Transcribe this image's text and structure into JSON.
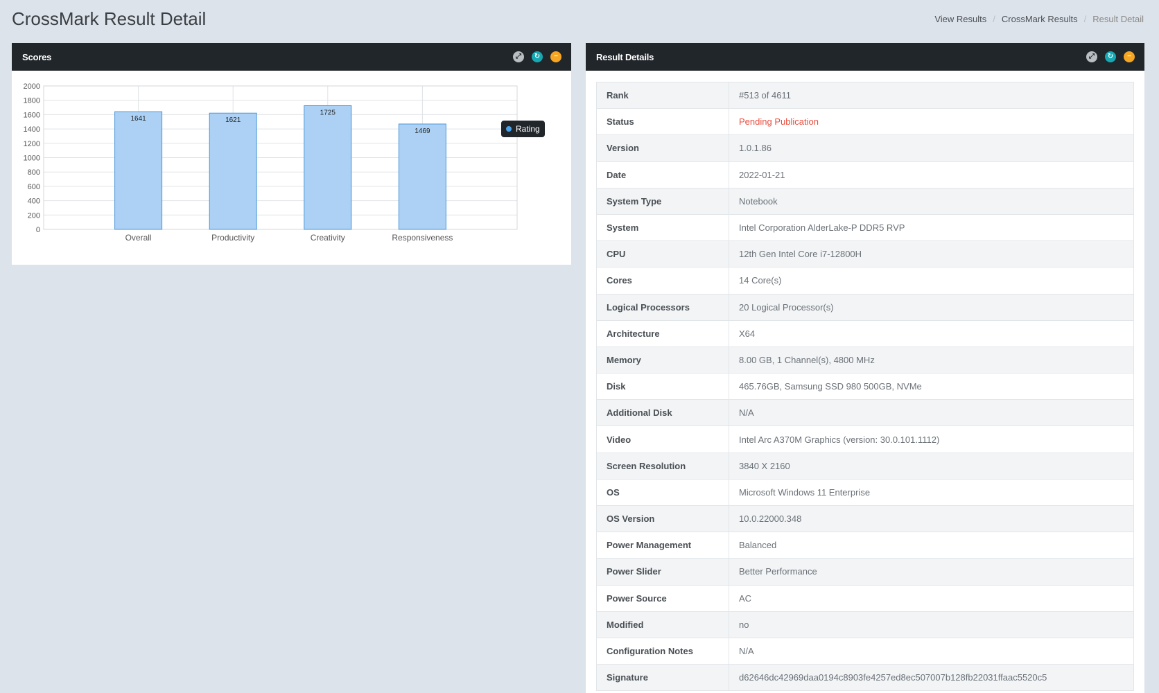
{
  "page": {
    "title": "CrossMark Result Detail",
    "breadcrumb": [
      "View Results",
      "CrossMark Results",
      "Result Detail"
    ]
  },
  "scores_panel": {
    "title": "Scores",
    "legend_label": "Rating",
    "tools": [
      "expand-icon",
      "refresh-icon",
      "minimize-icon"
    ]
  },
  "chart_data": {
    "type": "bar",
    "categories": [
      "Overall",
      "Productivity",
      "Creativity",
      "Responsiveness"
    ],
    "series": [
      {
        "name": "Rating",
        "values": [
          1641,
          1621,
          1725,
          1469
        ]
      }
    ],
    "data_labels": [
      "1641",
      "1621",
      "1725",
      "1469"
    ],
    "yticks": [
      "0",
      "200",
      "400",
      "600",
      "800",
      "1000",
      "1200",
      "1400",
      "1600",
      "1800",
      "2000"
    ],
    "ylim": [
      0,
      2000
    ],
    "grid": true,
    "legend_position": "top-right",
    "colors": {
      "bar_fill": "#acd1f5",
      "bar_stroke": "#4a96d9"
    }
  },
  "details_panel": {
    "title": "Result Details",
    "tools": [
      "expand-icon",
      "refresh-icon",
      "minimize-icon"
    ],
    "rows": [
      {
        "key": "Rank",
        "value": "#513 of 4611"
      },
      {
        "key": "Status",
        "value": "Pending Publication"
      },
      {
        "key": "Version",
        "value": "1.0.1.86"
      },
      {
        "key": "Date",
        "value": "2022-01-21"
      },
      {
        "key": "System Type",
        "value": "Notebook"
      },
      {
        "key": "System",
        "value": "Intel Corporation AlderLake-P DDR5 RVP"
      },
      {
        "key": "CPU",
        "value": "12th Gen Intel Core i7-12800H"
      },
      {
        "key": "Cores",
        "value": "14 Core(s)"
      },
      {
        "key": "Logical Processors",
        "value": "20 Logical Processor(s)"
      },
      {
        "key": "Architecture",
        "value": "X64"
      },
      {
        "key": "Memory",
        "value": "8.00 GB, 1 Channel(s), 4800 MHz"
      },
      {
        "key": "Disk",
        "value": "465.76GB, Samsung SSD 980 500GB, NVMe"
      },
      {
        "key": "Additional Disk",
        "value": "N/A"
      },
      {
        "key": "Video",
        "value": "Intel Arc A370M Graphics (version: 30.0.101.1112)"
      },
      {
        "key": "Screen Resolution",
        "value": "3840 X 2160"
      },
      {
        "key": "OS",
        "value": "Microsoft Windows 11 Enterprise"
      },
      {
        "key": "OS Version",
        "value": "10.0.22000.348"
      },
      {
        "key": "Power Management",
        "value": "Balanced"
      },
      {
        "key": "Power Slider",
        "value": "Better Performance"
      },
      {
        "key": "Power Source",
        "value": "AC"
      },
      {
        "key": "Modified",
        "value": "no"
      },
      {
        "key": "Configuration Notes",
        "value": "N/A"
      },
      {
        "key": "Signature",
        "value": "d62646dc42969daa0194c8903fe4257ed8ec507007b128fb22031ffaac5520c5"
      }
    ]
  },
  "colors": {
    "background": "#dde3ea",
    "panel_header": "#21262b",
    "status_pending": "#e84c3d",
    "tool_refresh": "#16a9b3",
    "tool_minimize": "#f6a623"
  }
}
